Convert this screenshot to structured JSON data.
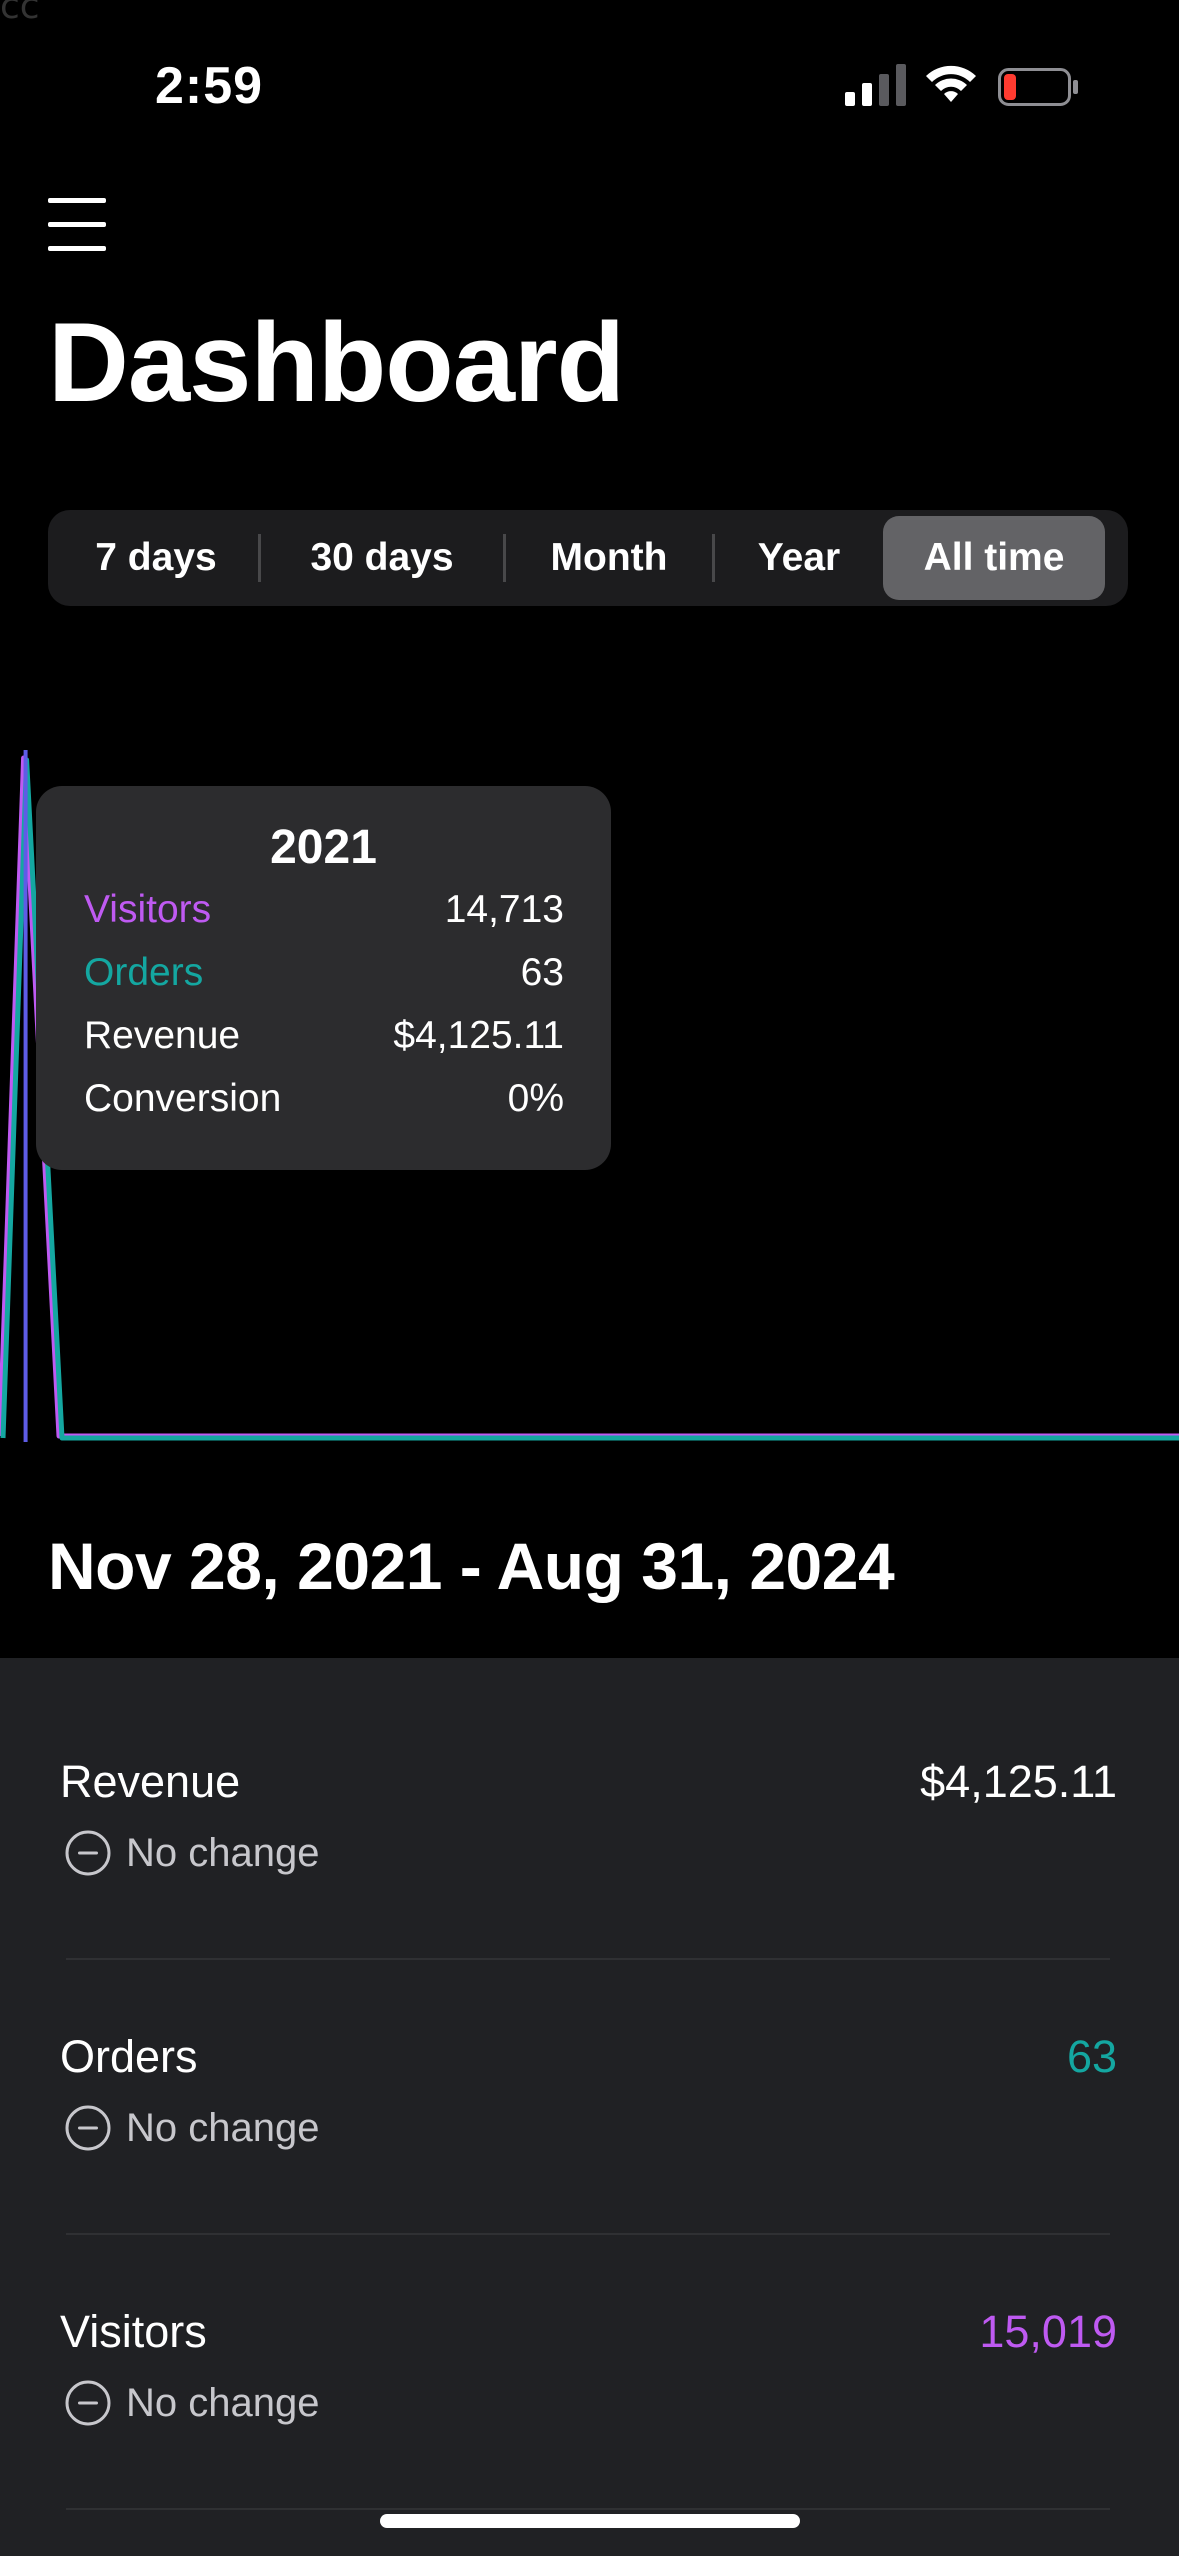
{
  "status_bar": {
    "corner_text": "cc",
    "time": "2:59",
    "icons": [
      "cellular-signal-icon",
      "wifi-icon",
      "battery-low-icon"
    ]
  },
  "header": {
    "menu_icon": "hamburger-menu-icon",
    "title": "Dashboard"
  },
  "range_selector": {
    "options": [
      "7 days",
      "30 days",
      "Month",
      "Year",
      "All time"
    ],
    "selected": "All time"
  },
  "colors": {
    "visitors": "#bf5af2",
    "orders": "#14a7a1",
    "cursor": "#5e5ce6",
    "background": "#000000",
    "panel": "#202124",
    "tooltip": "#2c2c2e",
    "segment_selected": "#636366"
  },
  "chart_data": {
    "type": "line",
    "x_range": [
      "Nov 28, 2021",
      "Aug 31, 2024"
    ],
    "series": [
      {
        "name": "Visitors",
        "color": "#bf5af2",
        "points": [
          [
            0.0,
            0
          ],
          [
            0.02,
            14713
          ],
          [
            0.05,
            0
          ],
          [
            1.0,
            0
          ]
        ]
      },
      {
        "name": "Orders",
        "color": "#14a7a1",
        "points": [
          [
            0.0,
            0
          ],
          [
            0.02,
            63
          ],
          [
            0.05,
            0
          ],
          [
            1.0,
            0
          ]
        ]
      }
    ],
    "cursor_x": 0.02,
    "tooltip": {
      "title": "2021",
      "rows": [
        {
          "label": "Visitors",
          "value": "14,713",
          "color": "#bf5af2"
        },
        {
          "label": "Orders",
          "value": "63",
          "color": "#14a7a1"
        },
        {
          "label": "Revenue",
          "value": "$4,125.11",
          "color": "#ffffff"
        },
        {
          "label": "Conversion",
          "value": "0%",
          "color": "#ffffff"
        }
      ]
    }
  },
  "date_range": "Nov 28, 2021 - Aug 31, 2024",
  "metrics": [
    {
      "label": "Revenue",
      "value": "$4,125.11",
      "value_color": "#ffffff",
      "change": "No change",
      "change_icon": "minus-circle-icon"
    },
    {
      "label": "Orders",
      "value": "63",
      "value_color": "#14a7a1",
      "change": "No change",
      "change_icon": "minus-circle-icon"
    },
    {
      "label": "Visitors",
      "value": "15,019",
      "value_color": "#bf5af2",
      "change": "No change",
      "change_icon": "minus-circle-icon"
    }
  ]
}
